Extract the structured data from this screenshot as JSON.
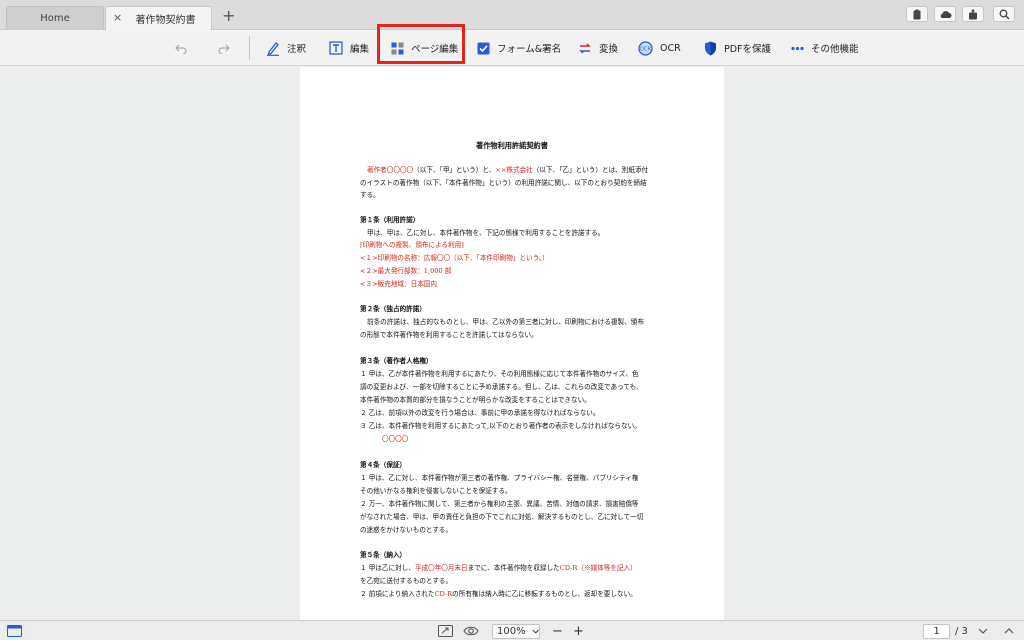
{
  "tabs": {
    "home": "Home",
    "document": "著作物契約書",
    "close": "×",
    "add": "+"
  },
  "toolbar": {
    "comment": "注釈",
    "edit": "編集",
    "page_edit": "ページ編集",
    "form_sign": "フォーム&署名",
    "convert": "変換",
    "ocr": "OCR",
    "protect": "PDFを保護",
    "more": "その他機能"
  },
  "document": {
    "title": "著作物利用許諾契約書",
    "intro1_a": "著作者〇〇〇〇",
    "intro1_b": "（以下、「甲」という）と、",
    "intro1_c": "××株式会社",
    "intro1_d": "（以下、「乙」という）とは、別紙添付",
    "intro2": "のイラストの著作物（以下、「本件著作物」という）の利用許諾に関し、以下のとおり契約を締結",
    "intro3": "する。",
    "a1_head": "第１条（利用許諾）",
    "a1_l1": "甲は、甲は、乙に対し、本件著作物を、下記の態様で利用することを許諾する。",
    "a1_l2": "[印刷物への複製、頒布による利用]",
    "a1_l3": "<１>印刷物の名称：広報〇〇（以下、「本件印刷物」という。）",
    "a1_l4": "<２>最大発行部数：1,000 部",
    "a1_l5": "<３>販売地域：日本国内",
    "a2_head": "第２条（独占的許諾）",
    "a2_l1": "前条の許諾は、独占的なものとし、甲は、乙以外の第三者に対し、印刷物における複製、頒布",
    "a2_l2": "の形態で本件著作物を利用することを許諾してはならない。",
    "a3_head": "第３条（著作者人格権）",
    "a3_l1": "１ 甲は、乙が本件著作物を利用するにあたり、その利用態様に応じて本件著作物のサイズ、色",
    "a3_l2": "調の変更および、一部を切除することに予め承諾する。但し、乙は、これらの改変であっても、",
    "a3_l3": "本件著作物の本質的部分を損なうことが明らかな改変をすることはできない。",
    "a3_l4": "２ 乙は、前項以外の改変を行う場合は、事前に甲の承諾を得なければならない。",
    "a3_l5": "３ 乙は、本件著作物を利用するにあたって,以下のとおり著作者の表示をしなければならない。",
    "a3_l6": "〇〇〇〇",
    "a4_head": "第４条（保証）",
    "a4_l1": "１ 甲は、乙に対し、本件著作物が第三者の著作権、プライバシー権、名誉権、パブリシティ権",
    "a4_l2": "その他いかなる権利を侵害しないことを保証する。",
    "a4_l3": "２ 万一、本件著作物に関して、第三者から権利の主張、異議、苦情、対価の請求、損害賠償等",
    "a4_l4": "がなされた場合、甲は、甲の責任と負担の下でこれに対処、解決するものとし、乙に対して一切",
    "a4_l5": "の迷惑をかけないものとする。",
    "a5_head": "第５条（納入）",
    "a5_l1_a": "１ 甲は乙に対し、",
    "a5_l1_b": "平成〇年〇月末日",
    "a5_l1_c": "までに、本件著作物を収録した",
    "a5_l1_d": "CD-R（※媒体等を記入）",
    "a5_l2": "を乙宛に送付するものとする。",
    "a5_l3_a": "２ 前項により納入された",
    "a5_l3_b": "CD-R",
    "a5_l3_c": "の所有権は納入時に乙に移転するものとし、返却を要しない。"
  },
  "status": {
    "zoom": "100%",
    "minus": "−",
    "plus": "+",
    "page_current": "1",
    "page_total": "/ 3"
  },
  "colors": {
    "accent_red": "#e8231d",
    "text_red": "#d3241c",
    "icon_blue": "#2a5bd7"
  }
}
